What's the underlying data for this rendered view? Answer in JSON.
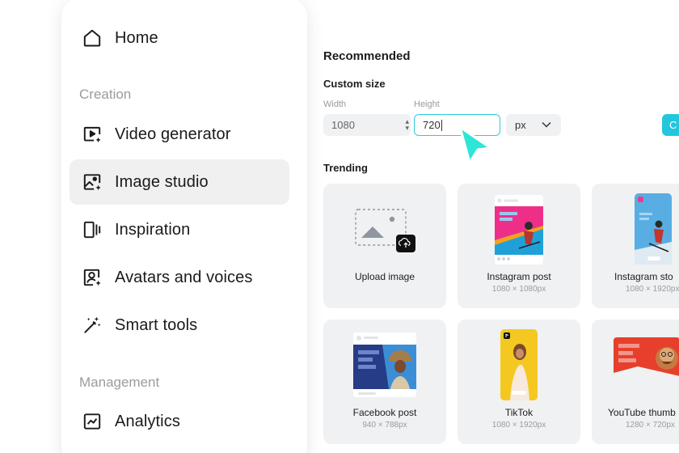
{
  "sidebar": {
    "home": "Home",
    "section_creation": "Creation",
    "items": [
      {
        "label": "Video generator",
        "icon": "video-sparkle-icon"
      },
      {
        "label": "Image studio",
        "icon": "image-sparkle-icon",
        "active": true
      },
      {
        "label": "Inspiration",
        "icon": "inspiration-icon"
      },
      {
        "label": "Avatars and voices",
        "icon": "avatar-icon"
      },
      {
        "label": "Smart tools",
        "icon": "magic-wand-icon"
      }
    ],
    "section_management": "Management",
    "analytics": "Analytics"
  },
  "main": {
    "recommended": "Recommended",
    "custom_size": "Custom size",
    "width_label": "Width",
    "width_value": "1080",
    "height_label": "Height",
    "height_value": "720",
    "unit": "px",
    "create_label": "C",
    "trending": "Trending"
  },
  "cards": [
    {
      "title": "Upload image",
      "dims": ""
    },
    {
      "title": "Instagram post",
      "dims": "1080 × 1080px"
    },
    {
      "title": "Instagram sto",
      "dims": "1080 × 1920px"
    },
    {
      "title": "Facebook post",
      "dims": "940 × 788px"
    },
    {
      "title": "TikTok",
      "dims": "1080 × 1920px"
    },
    {
      "title": "YouTube thumb",
      "dims": "1280 × 720px"
    }
  ],
  "colors": {
    "accent": "#22c7de",
    "active_bg": "#f0f0f1"
  }
}
